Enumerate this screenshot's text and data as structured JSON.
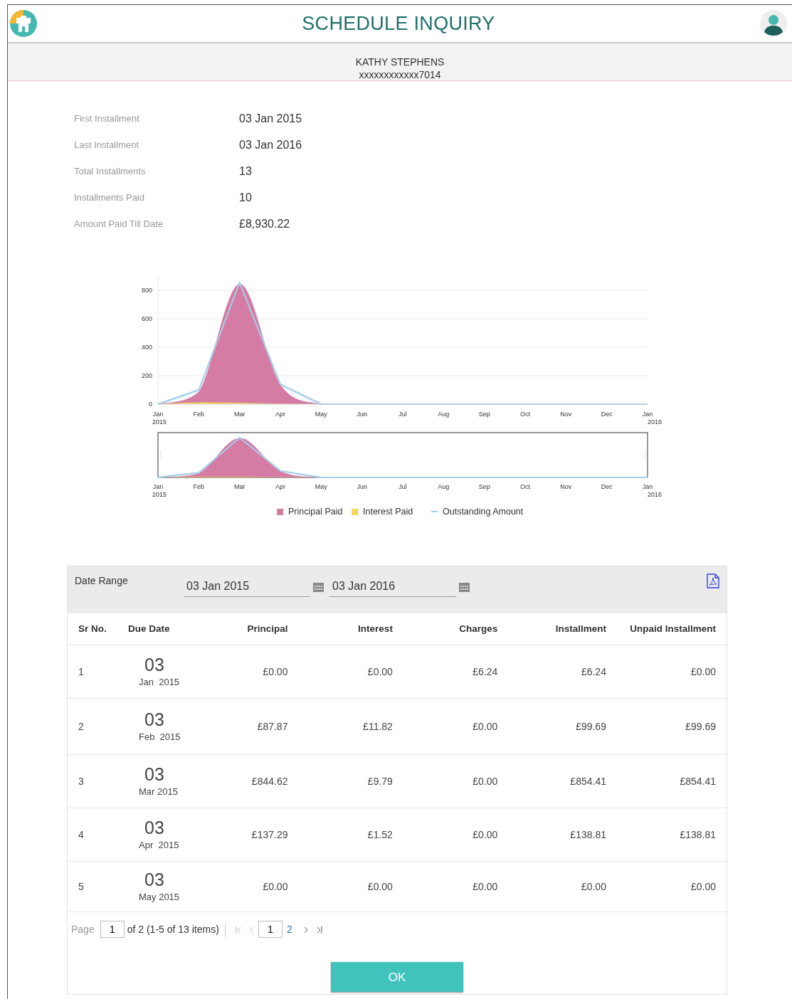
{
  "header": {
    "title": "SCHEDULE INQUIRY"
  },
  "customer": {
    "name": "KATHY STEPHENS",
    "account": "xxxxxxxxxxxx7014"
  },
  "summary": [
    {
      "label": "First Installment",
      "value": "03 Jan 2015"
    },
    {
      "label": "Last Installment",
      "value": "03 Jan 2016"
    },
    {
      "label": "Total Installments",
      "value": "13"
    },
    {
      "label": "Installments Paid",
      "value": "10"
    },
    {
      "label": "Amount Paid Till Date",
      "value": "£8,930.22"
    }
  ],
  "chart": {
    "chart_data": {
      "type": "area",
      "stacked": false,
      "grid": true,
      "legend": true,
      "categories": [
        "Jan 2015",
        "Feb",
        "Mar",
        "Apr",
        "May",
        "Jun",
        "Jul",
        "Aug",
        "Sep",
        "Oct",
        "Nov",
        "Dec",
        "Jan 2016"
      ],
      "yticks": [
        0,
        200,
        400,
        600,
        800
      ],
      "ylim": [
        0,
        900
      ],
      "series": [
        {
          "name": "Principal Paid",
          "color": "#d47ca4",
          "values": [
            0,
            88,
            845,
            137,
            0,
            0,
            0,
            0,
            0,
            0,
            0,
            0,
            0
          ]
        },
        {
          "name": "Interest Paid",
          "color": "#f7d55c",
          "values": [
            0,
            12,
            10,
            2,
            0,
            0,
            0,
            0,
            0,
            0,
            0,
            0,
            0
          ]
        },
        {
          "name": "Outstanding Amount",
          "color": "#a7cfeb",
          "values": [
            0,
            100,
            854,
            139,
            0,
            0,
            0,
            0,
            0,
            0,
            0,
            0,
            0
          ]
        }
      ]
    },
    "navigator_labels": [
      "Jan 2015",
      "Feb",
      "Mar",
      "Apr",
      "May",
      "Jun",
      "Jul",
      "Aug",
      "Sep",
      "Oct",
      "Nov",
      "Dec",
      "Jan 2016"
    ]
  },
  "filter": {
    "label": "Date Range",
    "from": "03 Jan 2015",
    "to": "03 Jan 2016"
  },
  "table": {
    "columns": [
      "Sr No.",
      "Due Date",
      "Principal",
      "Interest",
      "Charges",
      "Installment",
      "Unpaid Installment"
    ],
    "rows": [
      {
        "sr": "1",
        "day": "03",
        "month": "Jan  2015",
        "principal": "£0.00",
        "interest": "£0.00",
        "charges": "£6.24",
        "installment": "£6.24",
        "unpaid": "£0.00"
      },
      {
        "sr": "2",
        "day": "03",
        "month": "Feb  2015",
        "principal": "£87.87",
        "interest": "£11.82",
        "charges": "£0.00",
        "installment": "£99.69",
        "unpaid": "£99.69"
      },
      {
        "sr": "3",
        "day": "03",
        "month": "Mar 2015",
        "principal": "£844.62",
        "interest": "£9.79",
        "charges": "£0.00",
        "installment": "£854.41",
        "unpaid": "£854.41"
      },
      {
        "sr": "4",
        "day": "03",
        "month": "Apr  2015",
        "principal": "£137.29",
        "interest": "£1.52",
        "charges": "£0.00",
        "installment": "£138.81",
        "unpaid": "£138.81"
      },
      {
        "sr": "5",
        "day": "03",
        "month": "May 2015",
        "principal": "£0.00",
        "interest": "£0.00",
        "charges": "£0.00",
        "installment": "£0.00",
        "unpaid": "£0.00"
      }
    ]
  },
  "pager": {
    "label": "Page",
    "page_value": "1",
    "summary": "of 2 (1-5  of 13 items)",
    "pages": [
      {
        "label": "1",
        "selected": true
      },
      {
        "label": "2",
        "selected": false
      }
    ],
    "first_disabled": true,
    "prev_disabled": true,
    "next_disabled": false,
    "last_disabled": false
  },
  "ok_button": "OK"
}
